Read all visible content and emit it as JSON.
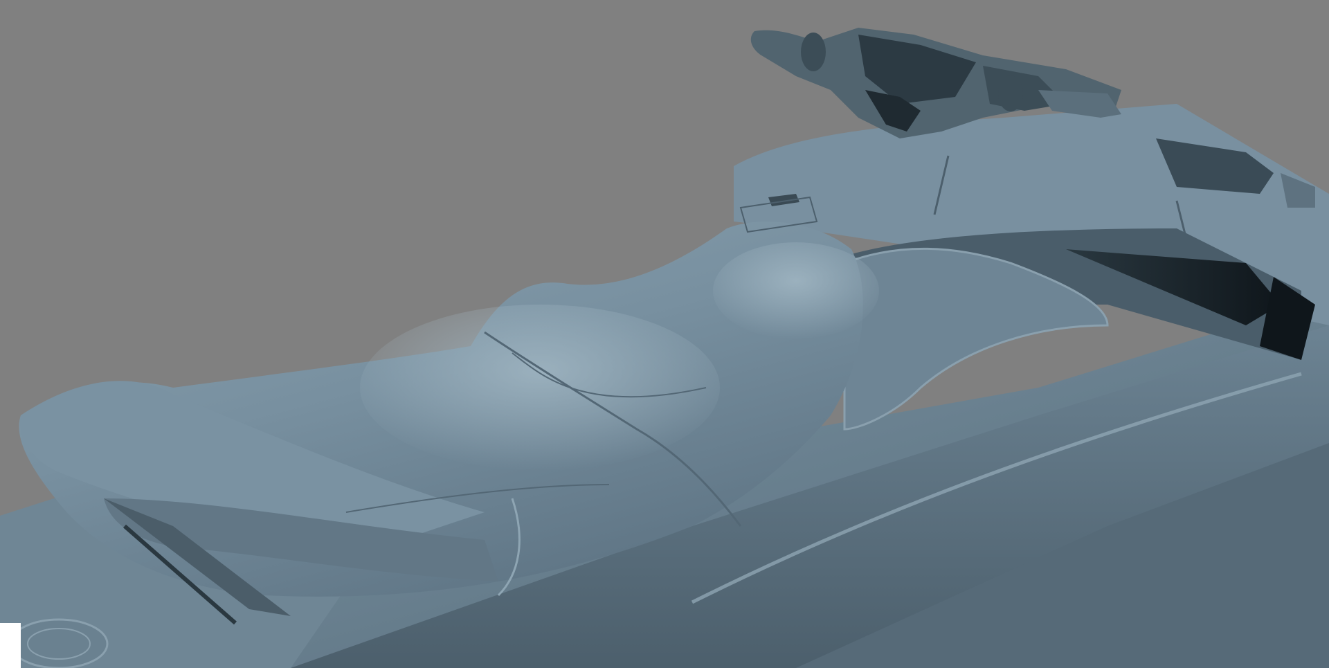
{
  "viewport": {
    "background_color": "#808080",
    "model_color": "#6f8796",
    "model_highlight": "#9db3c0",
    "model_shadow": "#3f525e",
    "model_dark": "#1f2a31"
  },
  "scene": {
    "parts": [
      {
        "id": "hull",
        "icon": "hull-surface"
      },
      {
        "id": "seat",
        "icon": "seat-surface"
      },
      {
        "id": "handlebar",
        "icon": "handlebar-assembly"
      },
      {
        "id": "side-vent",
        "icon": "vent-recess"
      },
      {
        "id": "grab-handle",
        "icon": "rear-grab-handle"
      },
      {
        "id": "footwell",
        "icon": "footwell-deck"
      }
    ]
  }
}
